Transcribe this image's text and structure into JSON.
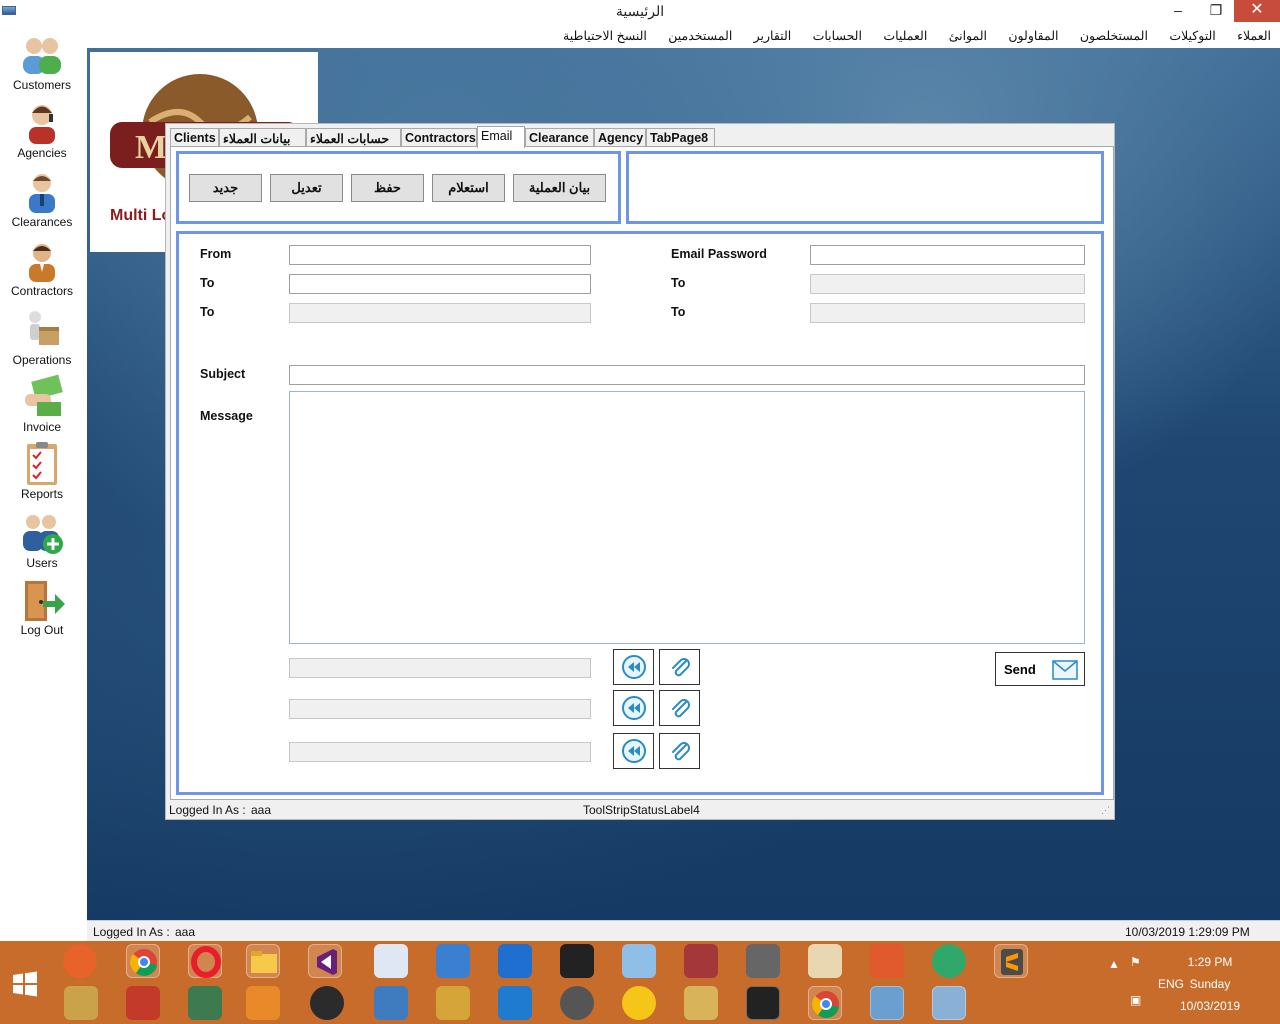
{
  "window": {
    "title": "الرئيسية",
    "minimize": "–",
    "restore": "❐",
    "close": "✕"
  },
  "menu": [
    "العملاء",
    "التوكيلات",
    "المستخلصون",
    "المقاولون",
    "الموانئ",
    "العمليات",
    "الحسابات",
    "التقارير",
    "المستخدمين",
    "النسخ الاحتياطية"
  ],
  "sidebar": [
    {
      "label": "Customers",
      "icon": "customers-icon"
    },
    {
      "label": "Agencies",
      "icon": "agencies-icon"
    },
    {
      "label": "Clearances",
      "icon": "clearances-icon"
    },
    {
      "label": "Contractors",
      "icon": "contractors-icon"
    },
    {
      "label": "Operations",
      "icon": "operations-icon"
    },
    {
      "label": "Invoice",
      "icon": "invoice-icon"
    },
    {
      "label": "Reports",
      "icon": "reports-icon"
    },
    {
      "label": "Users",
      "icon": "users-icon"
    },
    {
      "label": "Log Out",
      "icon": "logout-icon"
    }
  ],
  "logo": {
    "text": "Multi Lo"
  },
  "tabs": [
    {
      "label": "Clients"
    },
    {
      "label": "بيانات العملاء"
    },
    {
      "label": "حسابات العملاء"
    },
    {
      "label": "Contractors"
    },
    {
      "label": "Email"
    },
    {
      "label": "Clearance"
    },
    {
      "label": "Agency"
    },
    {
      "label": "TabPage8"
    }
  ],
  "active_tab": "Email",
  "actions": {
    "new": "جديد",
    "edit": "تعديل",
    "save": "حفظ",
    "query": "استعلام",
    "operation_details": "بيان العملية"
  },
  "email": {
    "from_label": "From",
    "to_label_1": "To",
    "to_label_2": "To",
    "password_label": "Email Password",
    "to_label_3": "To",
    "to_label_4": "To",
    "subject_label": "Subject",
    "message_label": "Message",
    "from_value": "",
    "to_value_1": "",
    "to_value_2": "",
    "password_value": "",
    "to_value_3": "",
    "to_value_4": "",
    "subject_value": "",
    "message_value": "",
    "send_label": "Send"
  },
  "attachments": [
    {
      "path": ""
    },
    {
      "path": ""
    },
    {
      "path": ""
    }
  ],
  "form_status": {
    "logged_in": "Logged In As :",
    "user": "aaa",
    "label4": "ToolStripStatusLabel4"
  },
  "main_status": {
    "logged_in": "Logged In As :",
    "user": "aaa",
    "datetime": "10/03/2019 1:29:09 PM"
  },
  "taskbar": {
    "time": "1:29 PM",
    "day": "Sunday",
    "date": "10/03/2019",
    "lang": "ENG"
  },
  "colors": {
    "panel_border": "#6f96e4",
    "taskbar": "#c76c2a",
    "close_button": "#c74c3c"
  }
}
